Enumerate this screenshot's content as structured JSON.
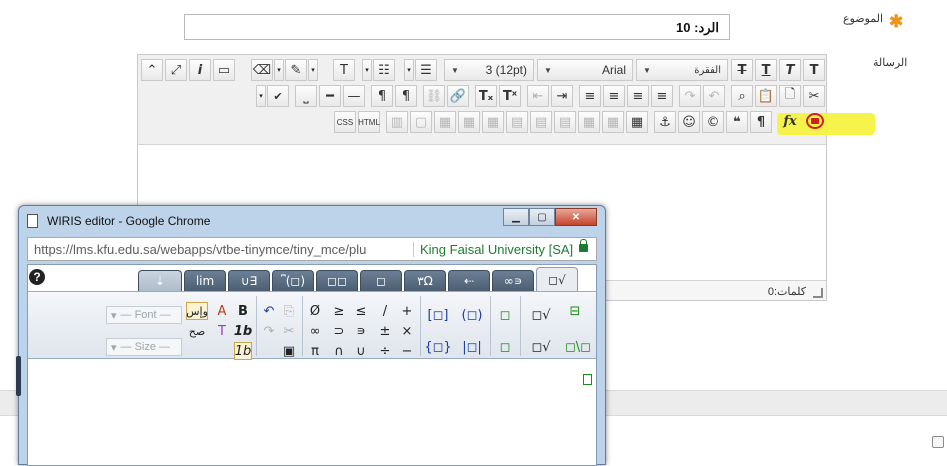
{
  "form": {
    "subject_label": "الموضوع",
    "subject_value": "الرد: 10",
    "message_label": "الرسالة"
  },
  "editor": {
    "font_size": "3 (12pt)",
    "font_family": "Arial",
    "paragraph": "الفقرة",
    "word_count": "كلمات:0",
    "css_label": "CSS",
    "html_label": "HTML",
    "highlight_color": "#f6f23a"
  },
  "popup": {
    "title": "WIRIS editor - Google Chrome",
    "url": "https://lms.kfu.edu.sa/webapps/vtbe-tinymce/tiny_mce/plu",
    "cert": "King Faisal University [SA]",
    "font_placeholder": "— Font —",
    "size_placeholder": "— Size —",
    "tabs": [
      "lim",
      "∪∃",
      "⎴(◻)",
      "◻◻",
      "◻",
      "٣Ω",
      "⇠",
      "∞∍",
      "◻√"
    ]
  }
}
